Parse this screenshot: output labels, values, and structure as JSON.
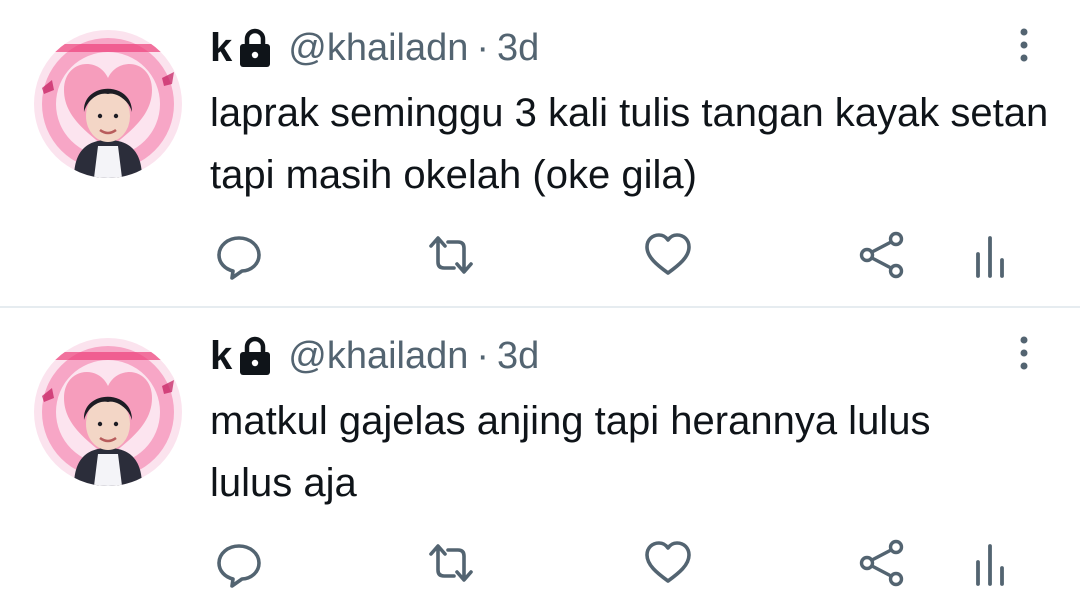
{
  "tweets": [
    {
      "display_name": "k",
      "handle": "@khailadn",
      "separator": "·",
      "time": "3d",
      "text": "laprak seminggu 3 kali tulis tangan kayak setan tapi masih okelah (oke gila)",
      "avatar_icon": "profile-avatar",
      "protected_icon": "lock-icon"
    },
    {
      "display_name": "k",
      "handle": "@khailadn",
      "separator": "·",
      "time": "3d",
      "text": "matkul gajelas anjing tapi herannya lulus lulus aja",
      "avatar_icon": "profile-avatar",
      "protected_icon": "lock-icon"
    }
  ],
  "action_icons": [
    "reply-icon",
    "retweet-icon",
    "like-icon",
    "share-icon",
    "analytics-icon"
  ],
  "colors": {
    "text_primary": "#0f1419",
    "text_secondary": "#536471",
    "divider": "#e6ecf0",
    "avatar_pink": "#f48fb1"
  }
}
